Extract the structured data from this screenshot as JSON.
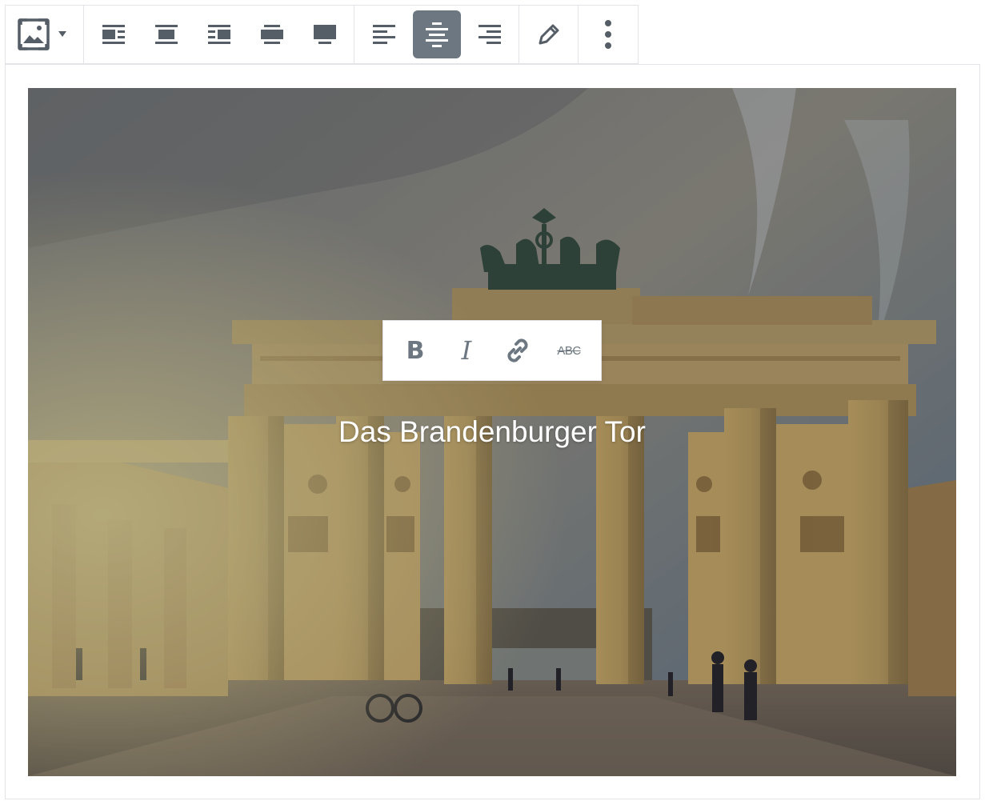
{
  "toolbar": {
    "groups": [
      {
        "name": "block-type",
        "items": [
          "cover-image-icon",
          "chevron-down-icon"
        ]
      },
      {
        "name": "block-alignment",
        "items": [
          "align-left-icon",
          "align-center-icon",
          "align-right-icon",
          "align-wide-icon",
          "align-full-icon"
        ]
      },
      {
        "name": "text-alignment",
        "items": [
          "text-align-left-icon",
          "text-align-center-icon",
          "text-align-right-icon"
        ],
        "active": "text-align-center-icon"
      },
      {
        "name": "edit",
        "items": [
          "pencil-icon"
        ]
      },
      {
        "name": "more",
        "items": [
          "more-vertical-icon"
        ]
      }
    ],
    "active_color": "#6c7781",
    "icon_color": "#555d66"
  },
  "format_toolbar": {
    "bold_label": "B",
    "italic_label": "I",
    "link_icon": "link-icon",
    "strike_label": "ABC"
  },
  "cover": {
    "title": "Das Brandenburger Tor",
    "overlay_color": "#000000"
  }
}
